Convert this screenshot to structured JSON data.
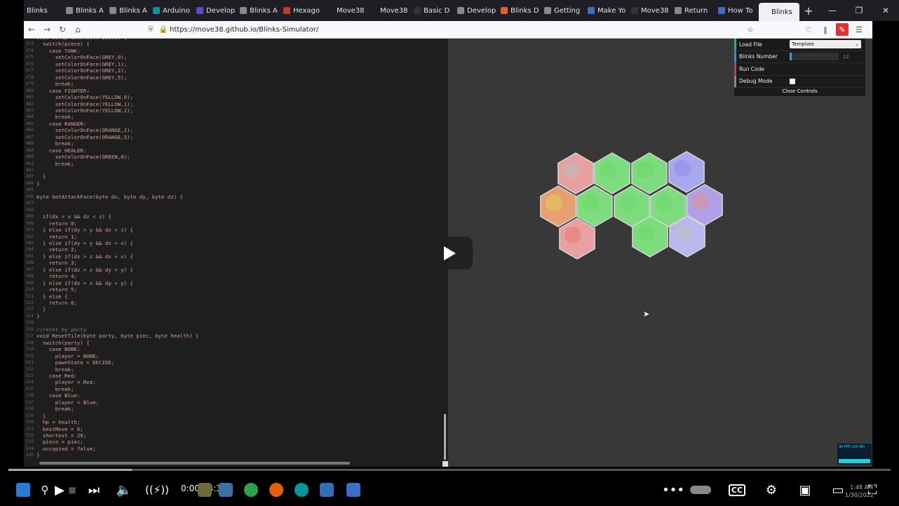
{
  "browser": {
    "tabs": [
      {
        "label": "Blinks",
        "color": "#1f1e25"
      },
      {
        "label": "Blinks A",
        "color": "#888888"
      },
      {
        "label": "Blinks A",
        "color": "#888888"
      },
      {
        "label": "Arduino",
        "color": "#00979c"
      },
      {
        "label": "Develop",
        "color": "#5a4bd1"
      },
      {
        "label": "Blinks A",
        "color": "#888888"
      },
      {
        "label": "Hexago",
        "color": "#c0392b"
      },
      {
        "label": "Move38",
        "color": "#1f1e25"
      },
      {
        "label": "Move38",
        "color": "#1f1e25"
      },
      {
        "label": "Basic D",
        "color": "#333333"
      },
      {
        "label": "Develop",
        "color": "#888888"
      },
      {
        "label": "Blinks D",
        "color": "#e85d24"
      },
      {
        "label": "Getting",
        "color": "#888888"
      },
      {
        "label": "Make Yo",
        "color": "#3b6ec9"
      },
      {
        "label": "Move38",
        "color": "#333333"
      },
      {
        "label": "Return",
        "color": "#888888"
      },
      {
        "label": "How To",
        "color": "#3b6ec9"
      },
      {
        "label": "Blinks",
        "color": "#f0f0f4"
      }
    ],
    "url": "https://move38.github.io/Blinks-Simulator/"
  },
  "code": [
    {
      "n": "",
      "t": "void SetupPiece(byte piece) {"
    },
    {
      "n": "473",
      "t": "  switch(piece) {"
    },
    {
      "n": "474",
      "t": "    case TANK:"
    },
    {
      "n": "475",
      "t": "      setColorOnFace(GREY,0);"
    },
    {
      "n": "476",
      "t": "      setColorOnFace(GREY,1);"
    },
    {
      "n": "477",
      "t": "      setColorOnFace(GREY,2);"
    },
    {
      "n": "478",
      "t": "      setColorOnFace(GREY,5);"
    },
    {
      "n": "479",
      "t": "      break;"
    },
    {
      "n": "480",
      "t": "    case FIGHTER:"
    },
    {
      "n": "481",
      "t": "      setColorOnFace(YELLOW,0);"
    },
    {
      "n": "482",
      "t": "      setColorOnFace(YELLOW,1);"
    },
    {
      "n": "483",
      "t": "      setColorOnFace(YELLOW,2);"
    },
    {
      "n": "484",
      "t": "      break;"
    },
    {
      "n": "485",
      "t": "    case RANGER:"
    },
    {
      "n": "486",
      "t": "      setColorOnFace(ORANGE,2);"
    },
    {
      "n": "487",
      "t": "      setColorOnFace(ORANGE,5);"
    },
    {
      "n": "488",
      "t": "      break;"
    },
    {
      "n": "489",
      "t": "    case HEALER:"
    },
    {
      "n": "490",
      "t": "      setColorOnFace(GREEN,0);"
    },
    {
      "n": "491",
      "t": "      break;"
    },
    {
      "n": "492",
      "t": ""
    },
    {
      "n": "493",
      "t": "  }"
    },
    {
      "n": "494",
      "t": "}"
    },
    {
      "n": "495",
      "t": ""
    },
    {
      "n": "496",
      "t": "byte GetAttackFace(byte dx, byte dy, byte dz) {"
    },
    {
      "n": "497",
      "t": ""
    },
    {
      "n": "498",
      "t": ""
    },
    {
      "n": "499",
      "t": "  if(dx > x && dz < z) {"
    },
    {
      "n": "500",
      "t": "    return 0;"
    },
    {
      "n": "501",
      "t": "  } else if(dy > y && dz < z) {"
    },
    {
      "n": "502",
      "t": "    return 1;"
    },
    {
      "n": "503",
      "t": "  } else if(dy > y && dx < x) {"
    },
    {
      "n": "504",
      "t": "    return 2;"
    },
    {
      "n": "505",
      "t": "  } else if(dz > z && dx < x) {"
    },
    {
      "n": "506",
      "t": "    return 3;"
    },
    {
      "n": "507",
      "t": "  } else if(dz > z && dy < y) {"
    },
    {
      "n": "508",
      "t": "    return 4;"
    },
    {
      "n": "509",
      "t": "  } else if(dx > x && dy < y) {"
    },
    {
      "n": "510",
      "t": "    return 5;"
    },
    {
      "n": "511",
      "t": "  } else {"
    },
    {
      "n": "512",
      "t": "    return 6;"
    },
    {
      "n": "513",
      "t": "  }"
    },
    {
      "n": "514",
      "t": "}"
    },
    {
      "n": "515",
      "t": ""
    },
    {
      "n": "516",
      "t": "//reset by party"
    },
    {
      "n": "517",
      "t": "void ResetTile(byte party, byte piec, byte health) {"
    },
    {
      "n": "518",
      "t": "  switch(party) {"
    },
    {
      "n": "519",
      "t": "    case NONE:"
    },
    {
      "n": "520",
      "t": "      player = NONE;"
    },
    {
      "n": "521",
      "t": "      pawnState = DECIDE;"
    },
    {
      "n": "522",
      "t": "      break;"
    },
    {
      "n": "523",
      "t": "    case Red:"
    },
    {
      "n": "524",
      "t": "      player = Red;"
    },
    {
      "n": "525",
      "t": "      break;"
    },
    {
      "n": "526",
      "t": "    case Blue:"
    },
    {
      "n": "527",
      "t": "      player = Blue;"
    },
    {
      "n": "528",
      "t": "      break;"
    },
    {
      "n": "529",
      "t": "  }"
    },
    {
      "n": "530",
      "t": "  hp = health;"
    },
    {
      "n": "531",
      "t": "  bestMove = 6;"
    },
    {
      "n": "532",
      "t": "  shortest = 20;"
    },
    {
      "n": "533",
      "t": "  piece = piec;"
    },
    {
      "n": "534",
      "t": "  occupied = false;"
    },
    {
      "n": "535",
      "t": "}"
    }
  ],
  "controls": {
    "load_file_label": "Load File",
    "load_file_value": "Template",
    "blinks_number_label": "Blinks Number",
    "blinks_number_value": "12",
    "blinks_number_fraction": 0.04,
    "run_code_label": "Run Code",
    "debug_mode_label": "Debug Mode",
    "close_label": "Close Controls"
  },
  "hexagons": [
    {
      "color": "#e6a0a0",
      "tint": "#bbbbbb"
    },
    {
      "color": "#7ddc7d",
      "tint": "#6bd86b"
    },
    {
      "color": "#7ddc7d",
      "tint": "#6bd86b"
    },
    {
      "color": "#a8a8ee",
      "tint": "#8c8cf0"
    },
    {
      "color": "#e8a070",
      "tint": "#e0d060"
    },
    {
      "color": "#7ddc7d",
      "tint": "#6bd86b"
    },
    {
      "color": "#7ddc7d",
      "tint": "#6bd86b"
    },
    {
      "color": "#7ddc7d",
      "tint": "#6bd86b"
    },
    {
      "color": "#b0a0e8",
      "tint": "#e09090"
    },
    {
      "color": "#e8a0a0",
      "tint": "#e87878"
    },
    {
      "color": "#7ddc7d",
      "tint": "#6bd86b"
    },
    {
      "color": "#b8b8ee",
      "tint": "#c0c0c0"
    }
  ],
  "fps_text": "30 FPS (10-30)",
  "player": {
    "time": "0:00 / 4:39",
    "progress_fraction": 0.14
  },
  "clock": {
    "time": "1:48 AM",
    "date": "1/30/2022"
  }
}
